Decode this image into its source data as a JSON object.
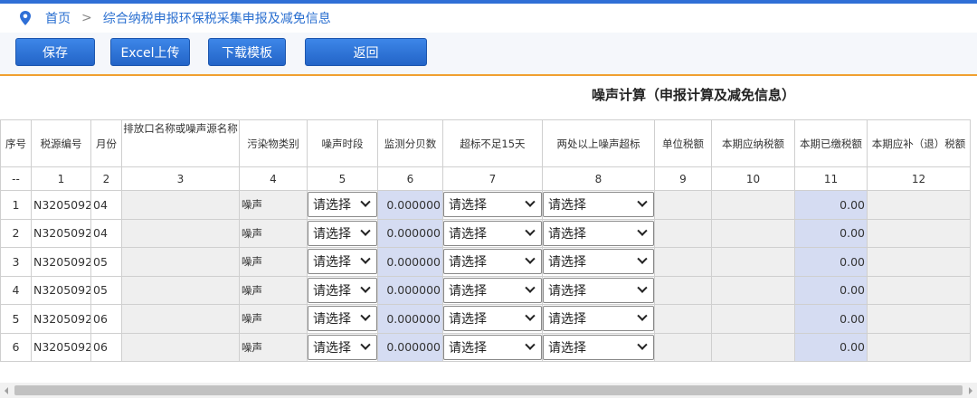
{
  "breadcrumb": {
    "home": "首页",
    "separator": ">",
    "current": "综合纳税申报环保税采集申报及减免信息"
  },
  "toolbar": {
    "save": "保存",
    "excel_upload": "Excel上传",
    "download_template": "下载模板",
    "back": "返回"
  },
  "page_title": "噪声计算（申报计算及减免信息）",
  "table": {
    "headers": [
      "序号",
      "税源编号",
      "月份",
      "排放口名称或噪声源名称",
      "污染物类别",
      "噪声时段",
      "监测分贝数",
      "超标不足15天",
      "两处以上噪声超标",
      "单位税额",
      "本期应纳税额",
      "本期已缴税额",
      "本期应补（退）税额"
    ],
    "index_row": [
      "--",
      "1",
      "2",
      "3",
      "4",
      "5",
      "6",
      "7",
      "8",
      "9",
      "10",
      "11",
      "12"
    ],
    "select_placeholder": "请选择",
    "rows": [
      {
        "seq": "1",
        "source_id": "N3205092",
        "month": "04",
        "outlet": "",
        "pollutant": "噪声",
        "period": "请选择",
        "decibel": "0.000000",
        "under15": "请选择",
        "multi": "请选择",
        "unit_tax": "",
        "payable": "",
        "paid": "0.00",
        "refund": ""
      },
      {
        "seq": "2",
        "source_id": "N3205092",
        "month": "04",
        "outlet": "",
        "pollutant": "噪声",
        "period": "请选择",
        "decibel": "0.000000",
        "under15": "请选择",
        "multi": "请选择",
        "unit_tax": "",
        "payable": "",
        "paid": "0.00",
        "refund": ""
      },
      {
        "seq": "3",
        "source_id": "N3205092",
        "month": "05",
        "outlet": "",
        "pollutant": "噪声",
        "period": "请选择",
        "decibel": "0.000000",
        "under15": "请选择",
        "multi": "请选择",
        "unit_tax": "",
        "payable": "",
        "paid": "0.00",
        "refund": ""
      },
      {
        "seq": "4",
        "source_id": "N3205092",
        "month": "05",
        "outlet": "",
        "pollutant": "噪声",
        "period": "请选择",
        "decibel": "0.000000",
        "under15": "请选择",
        "multi": "请选择",
        "unit_tax": "",
        "payable": "",
        "paid": "0.00",
        "refund": ""
      },
      {
        "seq": "5",
        "source_id": "N3205092",
        "month": "06",
        "outlet": "",
        "pollutant": "噪声",
        "period": "请选择",
        "decibel": "0.000000",
        "under15": "请选择",
        "multi": "请选择",
        "unit_tax": "",
        "payable": "",
        "paid": "0.00",
        "refund": ""
      },
      {
        "seq": "6",
        "source_id": "N3205092",
        "month": "06",
        "outlet": "",
        "pollutant": "噪声",
        "period": "请选择",
        "decibel": "0.000000",
        "under15": "请选择",
        "multi": "请选择",
        "unit_tax": "",
        "payable": "",
        "paid": "0.00",
        "refund": ""
      }
    ]
  },
  "colors": {
    "accent": "#2f6fd6",
    "button": "#2a6fd0",
    "divider": "#f0a030",
    "readonly_blue": "#d5dcf2"
  },
  "icons": {
    "breadcrumb": "location-pin-icon"
  }
}
